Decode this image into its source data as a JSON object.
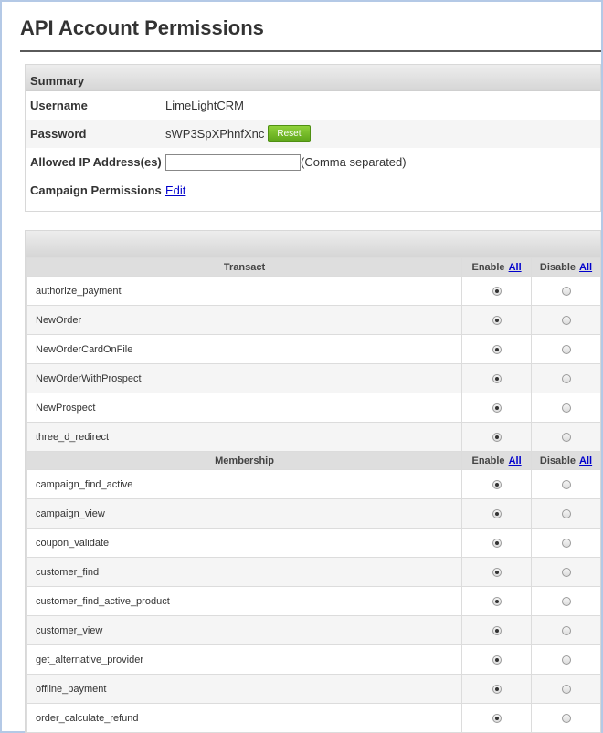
{
  "page": {
    "title": "API Account Permissions"
  },
  "summary": {
    "header": "Summary",
    "username_label": "Username",
    "username_value": "LimeLightCRM",
    "password_label": "Password",
    "password_value": "sWP3SpXPhnfXnc",
    "reset_label": "Reset",
    "ip_label": "Allowed IP Address(es)",
    "ip_value": "",
    "ip_hint": "(Comma separated)",
    "campaign_label": "Campaign Permissions",
    "edit_label": "Edit"
  },
  "permissions": {
    "enable_label": "Enable",
    "disable_label": "Disable",
    "all_label": "All",
    "groups": [
      {
        "name": "Transact",
        "items": [
          {
            "name": "authorize_payment",
            "enabled": true
          },
          {
            "name": "NewOrder",
            "enabled": true
          },
          {
            "name": "NewOrderCardOnFile",
            "enabled": true
          },
          {
            "name": "NewOrderWithProspect",
            "enabled": true
          },
          {
            "name": "NewProspect",
            "enabled": true
          },
          {
            "name": "three_d_redirect",
            "enabled": true
          }
        ]
      },
      {
        "name": "Membership",
        "items": [
          {
            "name": "campaign_find_active",
            "enabled": true
          },
          {
            "name": "campaign_view",
            "enabled": true
          },
          {
            "name": "coupon_validate",
            "enabled": true
          },
          {
            "name": "customer_find",
            "enabled": true
          },
          {
            "name": "customer_find_active_product",
            "enabled": true
          },
          {
            "name": "customer_view",
            "enabled": true
          },
          {
            "name": "get_alternative_provider",
            "enabled": true
          },
          {
            "name": "offline_payment",
            "enabled": true
          },
          {
            "name": "order_calculate_refund",
            "enabled": true
          }
        ]
      }
    ]
  }
}
